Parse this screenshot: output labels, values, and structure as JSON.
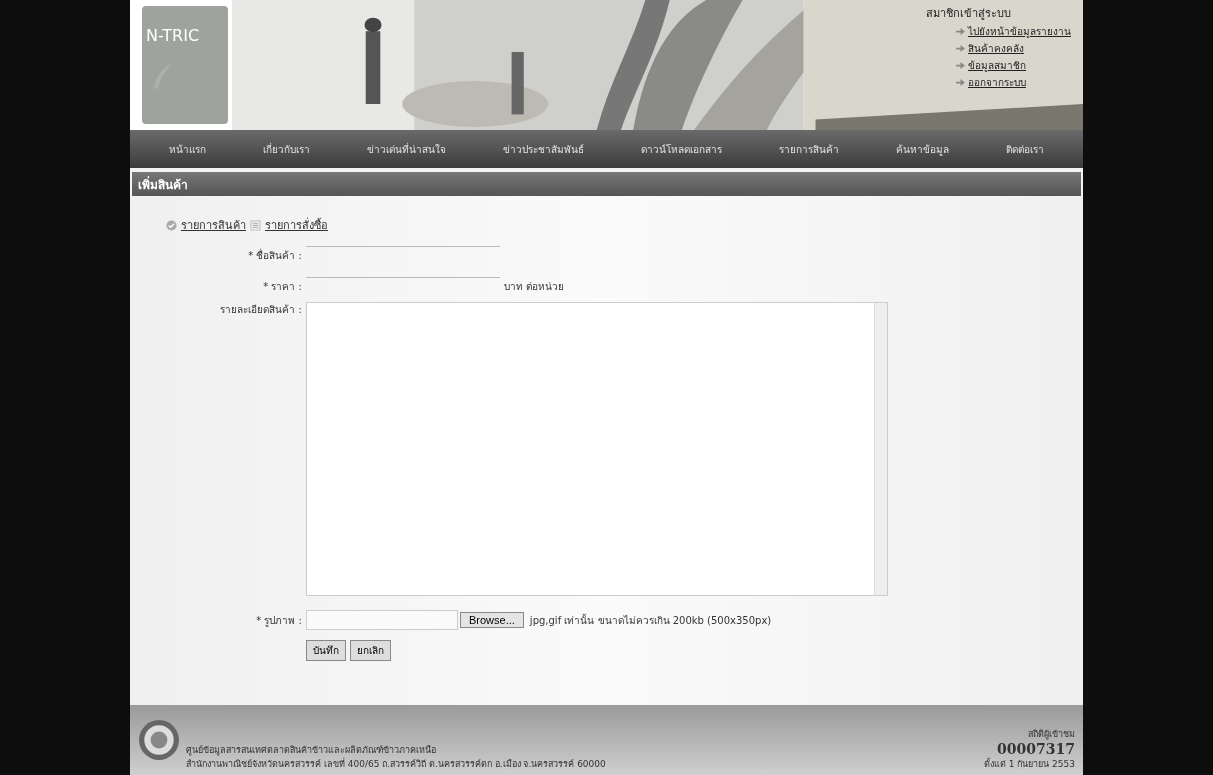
{
  "header": {
    "logo": "N-TRIC",
    "member_title": "สมาชิกเข้าสู่ระบบ",
    "member_links": [
      "ไปยังหน้าข้อมูลรายงาน",
      "สินค้าคงคลัง",
      "ข้อมูลสมาชิก",
      "ออกจากระบบ"
    ]
  },
  "nav": [
    "หน้าแรก",
    "เกี่ยวกับเรา",
    "ข่าวเด่นที่น่าสนใจ",
    "ข่าวประชาสัมพันธ์",
    "ดาวน์โหลดเอกสาร",
    "รายการสินค้า",
    "ค้นหาข้อมูล",
    "ติดต่อเรา"
  ],
  "page_title": "เพิ่มสินค้า",
  "tabs": [
    {
      "label": "รายการสินค้า",
      "kind": "check"
    },
    {
      "label": "รายการสั่งซื้อ",
      "kind": "list"
    }
  ],
  "form": {
    "name_label": "* ชื่อสินค้า :",
    "price_label": "* ราคา :",
    "price_unit": "บาท ต่อหน่วย",
    "detail_label": "รายละเอียดสินค้า :",
    "image_label": "* รูปภาพ :",
    "browse": "Browse...",
    "image_hint": "jpg,gif เท่านั้น ขนาดไม่ควรเกิน 200kb (500x350px)",
    "buttons": [
      "บันทึก",
      "ยกเลิก"
    ]
  },
  "footer": {
    "lines": [
      "ศูนย์ข้อมูลสารสนเทศตลาดสินค้าข้าวและผลิตภัณฑ์ข้าวภาคเหนือ",
      "สำนักงานพาณิชย์จังหวัดนครสวรรค์ เลขที่ 400/65 ถ.สวรรค์วิถี ต.นครสวรรค์ตก อ.เมือง จ.นครสวรรค์ 60000"
    ],
    "counter_label": "สถิติผู้เข้าชม",
    "counter": "00007317",
    "since": "ตั้งแต่ 1 กันยายน 2553"
  }
}
